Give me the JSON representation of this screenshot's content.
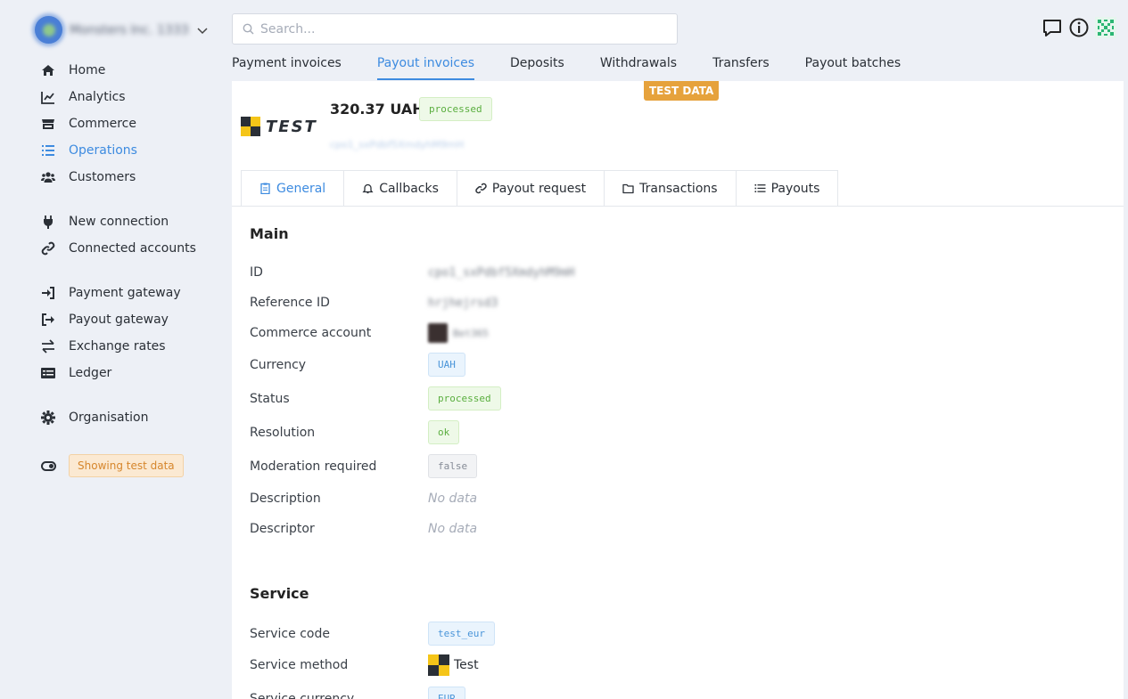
{
  "org": {
    "name": "Monsters Inc. 1333"
  },
  "search": {
    "placeholder": "Search..."
  },
  "sidebar": {
    "items": [
      {
        "label": "Home"
      },
      {
        "label": "Analytics"
      },
      {
        "label": "Commerce"
      },
      {
        "label": "Operations"
      },
      {
        "label": "Customers"
      },
      {
        "label": "New connection"
      },
      {
        "label": "Connected accounts"
      },
      {
        "label": "Payment gateway"
      },
      {
        "label": "Payout gateway"
      },
      {
        "label": "Exchange rates"
      },
      {
        "label": "Ledger"
      },
      {
        "label": "Organisation"
      }
    ],
    "test_badge": "Showing test data"
  },
  "top_tabs": [
    "Payment invoices",
    "Payout invoices",
    "Deposits",
    "Withdrawals",
    "Transfers",
    "Payout batches"
  ],
  "test_data_label": "TEST DATA",
  "invoice": {
    "brand": "TEST",
    "amount": "320.37 UAH",
    "status": "processed",
    "id_blurred": "cpo1_sxPdbf5XmdyhM9mH"
  },
  "detail_tabs": [
    "General",
    "Callbacks",
    "Payout request",
    "Transactions",
    "Payouts"
  ],
  "main_section": {
    "title": "Main",
    "id_label": "ID",
    "id_value": "cpo1_sxPdbf5XmdyhM9mH",
    "ref_label": "Reference ID",
    "ref_value": "hrjhejrsd3",
    "commerce_label": "Commerce account",
    "commerce_value": "Bet365",
    "currency_label": "Currency",
    "currency_value": "UAH",
    "status_label": "Status",
    "status_value": "processed",
    "resolution_label": "Resolution",
    "resolution_value": "ok",
    "moderation_label": "Moderation required",
    "moderation_value": "false",
    "description_label": "Description",
    "description_value": "No data",
    "descriptor_label": "Descriptor",
    "descriptor_value": "No data"
  },
  "service_section": {
    "title": "Service",
    "code_label": "Service code",
    "code_value": "test_eur",
    "method_label": "Service method",
    "method_value": "Test",
    "currency_label": "Service currency",
    "currency_value": "EUR"
  },
  "colors": {
    "accent": "#3d8be0",
    "test_orange": "#e6a23c",
    "success": "#5aae3f"
  }
}
